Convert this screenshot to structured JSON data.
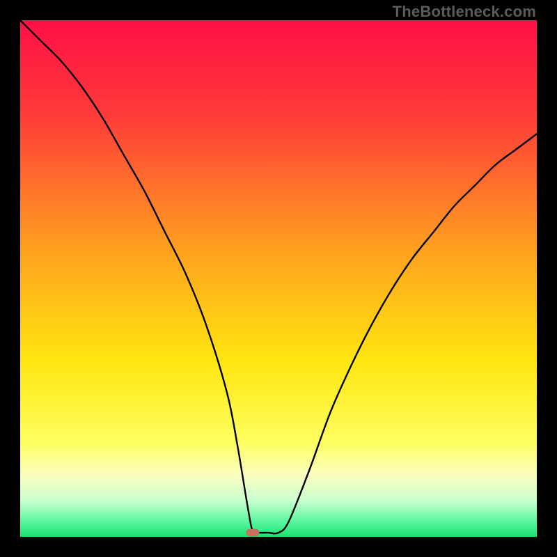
{
  "watermark": "TheBottleneck.com",
  "chart_data": {
    "type": "line",
    "title": "",
    "xlabel": "",
    "ylabel": "",
    "xlim": [
      0,
      100
    ],
    "ylim": [
      0,
      100
    ],
    "gradient_stops": [
      {
        "offset": 0,
        "color": "#ff0f46"
      },
      {
        "offset": 0.18,
        "color": "#ff3a3a"
      },
      {
        "offset": 0.45,
        "color": "#ffa21e"
      },
      {
        "offset": 0.66,
        "color": "#ffe610"
      },
      {
        "offset": 0.82,
        "color": "#fdff62"
      },
      {
        "offset": 0.88,
        "color": "#fbffc0"
      },
      {
        "offset": 0.93,
        "color": "#c9ffd0"
      },
      {
        "offset": 0.97,
        "color": "#5bf7a0"
      },
      {
        "offset": 1.0,
        "color": "#18e36f"
      }
    ],
    "curve": {
      "x": [
        0,
        4,
        8,
        12,
        16,
        20,
        24,
        28,
        32,
        36,
        40,
        42,
        44,
        45,
        46,
        48,
        50,
        52,
        56,
        60,
        64,
        68,
        72,
        76,
        80,
        84,
        88,
        92,
        96,
        100
      ],
      "y": [
        100,
        96,
        92,
        87,
        81,
        74,
        67,
        59,
        51,
        41,
        28,
        18,
        6,
        1,
        0.8,
        0.8,
        0.8,
        3,
        13,
        24,
        33,
        41,
        48,
        54,
        59,
        64,
        68,
        72,
        75,
        78
      ]
    },
    "marker": {
      "x": 45,
      "y": 0.8,
      "color": "#c96f5f",
      "width": 2.6,
      "height": 1.4
    }
  }
}
